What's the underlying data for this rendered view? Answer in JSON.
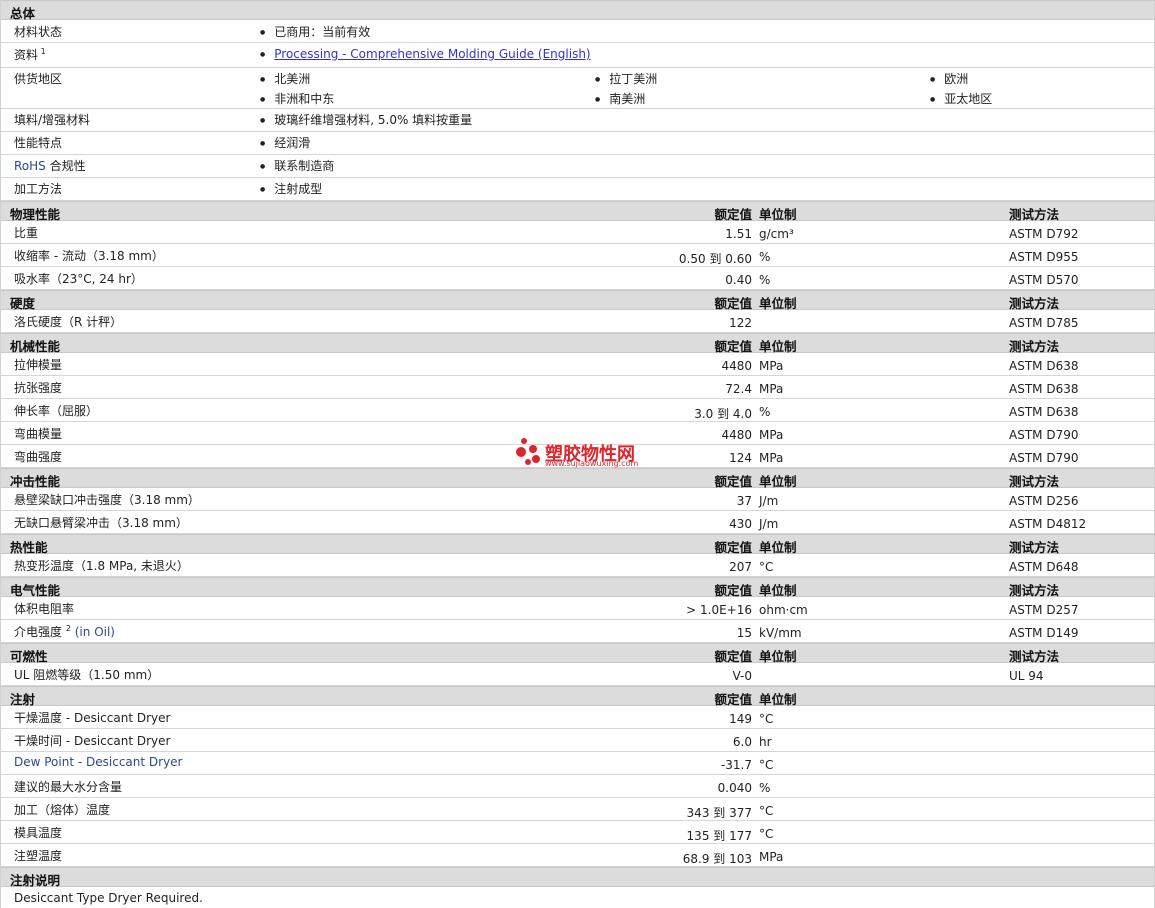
{
  "general": {
    "title": "总体",
    "rows": [
      {
        "label": "材料状态",
        "items": [
          "已商用：当前有效"
        ]
      },
      {
        "label": "资料",
        "sup": "1",
        "link": "Processing - Comprehensive Molding Guide (English)"
      },
      {
        "label": "供货地区",
        "items": [
          "北美洲",
          "拉丁美洲",
          "欧洲",
          "非洲和中东",
          "南美洲",
          "亚太地区"
        ]
      },
      {
        "label": "填料/增强材料",
        "items": [
          "玻璃纤维增强材料, 5.0% 填料按重量"
        ]
      },
      {
        "label": "性能特点",
        "items": [
          "经润滑"
        ]
      },
      {
        "label_a": "RoHS",
        "label_b": " 合规性",
        "items": [
          "联系制造商"
        ]
      },
      {
        "label": "加工方法",
        "items": [
          "注射成型"
        ]
      }
    ]
  },
  "col_headers": {
    "nominal": "额定值",
    "unit": "单位制",
    "method": "测试方法"
  },
  "sections": [
    {
      "title": "物理性能",
      "rows": [
        {
          "label": "比重",
          "value": "1.51",
          "unit": "g/cm³",
          "method": "ASTM D792"
        },
        {
          "label": "收缩率 - 流动（3.18 mm）",
          "value": "0.50 到 0.60",
          "unit": "%",
          "method": "ASTM D955"
        },
        {
          "label": "吸水率（23°C, 24 hr）",
          "value": "0.40",
          "unit": "%",
          "method": "ASTM D570"
        }
      ]
    },
    {
      "title": "硬度",
      "rows": [
        {
          "label": "洛氏硬度（R 计秤）",
          "value": "122",
          "unit": "",
          "method": "ASTM D785"
        }
      ]
    },
    {
      "title": "机械性能",
      "rows": [
        {
          "label": "拉伸模量",
          "value": "4480",
          "unit": "MPa",
          "method": "ASTM D638"
        },
        {
          "label": "抗张强度",
          "value": "72.4",
          "unit": "MPa",
          "method": "ASTM D638"
        },
        {
          "label": "伸长率（屈服）",
          "value": "3.0 到 4.0",
          "unit": "%",
          "method": "ASTM D638"
        },
        {
          "label": "弯曲模量",
          "value": "4480",
          "unit": "MPa",
          "method": "ASTM D790"
        },
        {
          "label": "弯曲强度",
          "value": "124",
          "unit": "MPa",
          "method": "ASTM D790"
        }
      ]
    },
    {
      "title": "冲击性能",
      "rows": [
        {
          "label": "悬壁梁缺口冲击强度（3.18 mm）",
          "value": "37",
          "unit": "J/m",
          "method": "ASTM D256"
        },
        {
          "label": "无缺口悬臂梁冲击（3.18 mm）",
          "value": "430",
          "unit": "J/m",
          "method": "ASTM D4812"
        }
      ]
    },
    {
      "title": "热性能",
      "rows": [
        {
          "label": "热变形温度（1.8 MPa, 未退火）",
          "value": "207",
          "unit": "°C",
          "method": "ASTM D648"
        }
      ]
    },
    {
      "title": "电气性能",
      "rows": [
        {
          "label": "体积电阻率",
          "value": "> 1.0E+16",
          "unit": "ohm·cm",
          "method": "ASTM D257"
        },
        {
          "label": "介电强度",
          "sup": "2",
          "label_tail": " (in Oil)",
          "value": "15",
          "unit": "kV/mm",
          "method": "ASTM D149"
        }
      ]
    },
    {
      "title": "可燃性",
      "rows": [
        {
          "label": "UL 阻燃等级（1.50 mm）",
          "value": "V-0",
          "unit": "",
          "method": "UL 94"
        }
      ]
    },
    {
      "title": "注射",
      "no_method": true,
      "rows": [
        {
          "label": "干燥温度 - Desiccant Dryer",
          "value": "149",
          "unit": "°C",
          "method": ""
        },
        {
          "label": "干燥时间 - Desiccant Dryer",
          "value": "6.0",
          "unit": "hr",
          "method": ""
        },
        {
          "label": "Dew Point - Desiccant Dryer",
          "value": "-31.7",
          "unit": "°C",
          "method": ""
        },
        {
          "label": "建议的最大水分含量",
          "value": "0.040",
          "unit": "%",
          "method": ""
        },
        {
          "label": "加工（熔体）温度",
          "value": "343 到 377",
          "unit": "°C",
          "method": ""
        },
        {
          "label": "模具温度",
          "value": "135 到 177",
          "unit": "°C",
          "method": ""
        },
        {
          "label": "注塑温度",
          "value": "68.9 到 103",
          "unit": "MPa",
          "method": ""
        }
      ]
    }
  ],
  "notes": {
    "title": "注射说明",
    "text": "Desiccant Type Dryer Required."
  },
  "watermark": {
    "brand": "塑胶物性网",
    "url": "www.sujiaowuxing.com",
    "color": "#e0242b"
  }
}
